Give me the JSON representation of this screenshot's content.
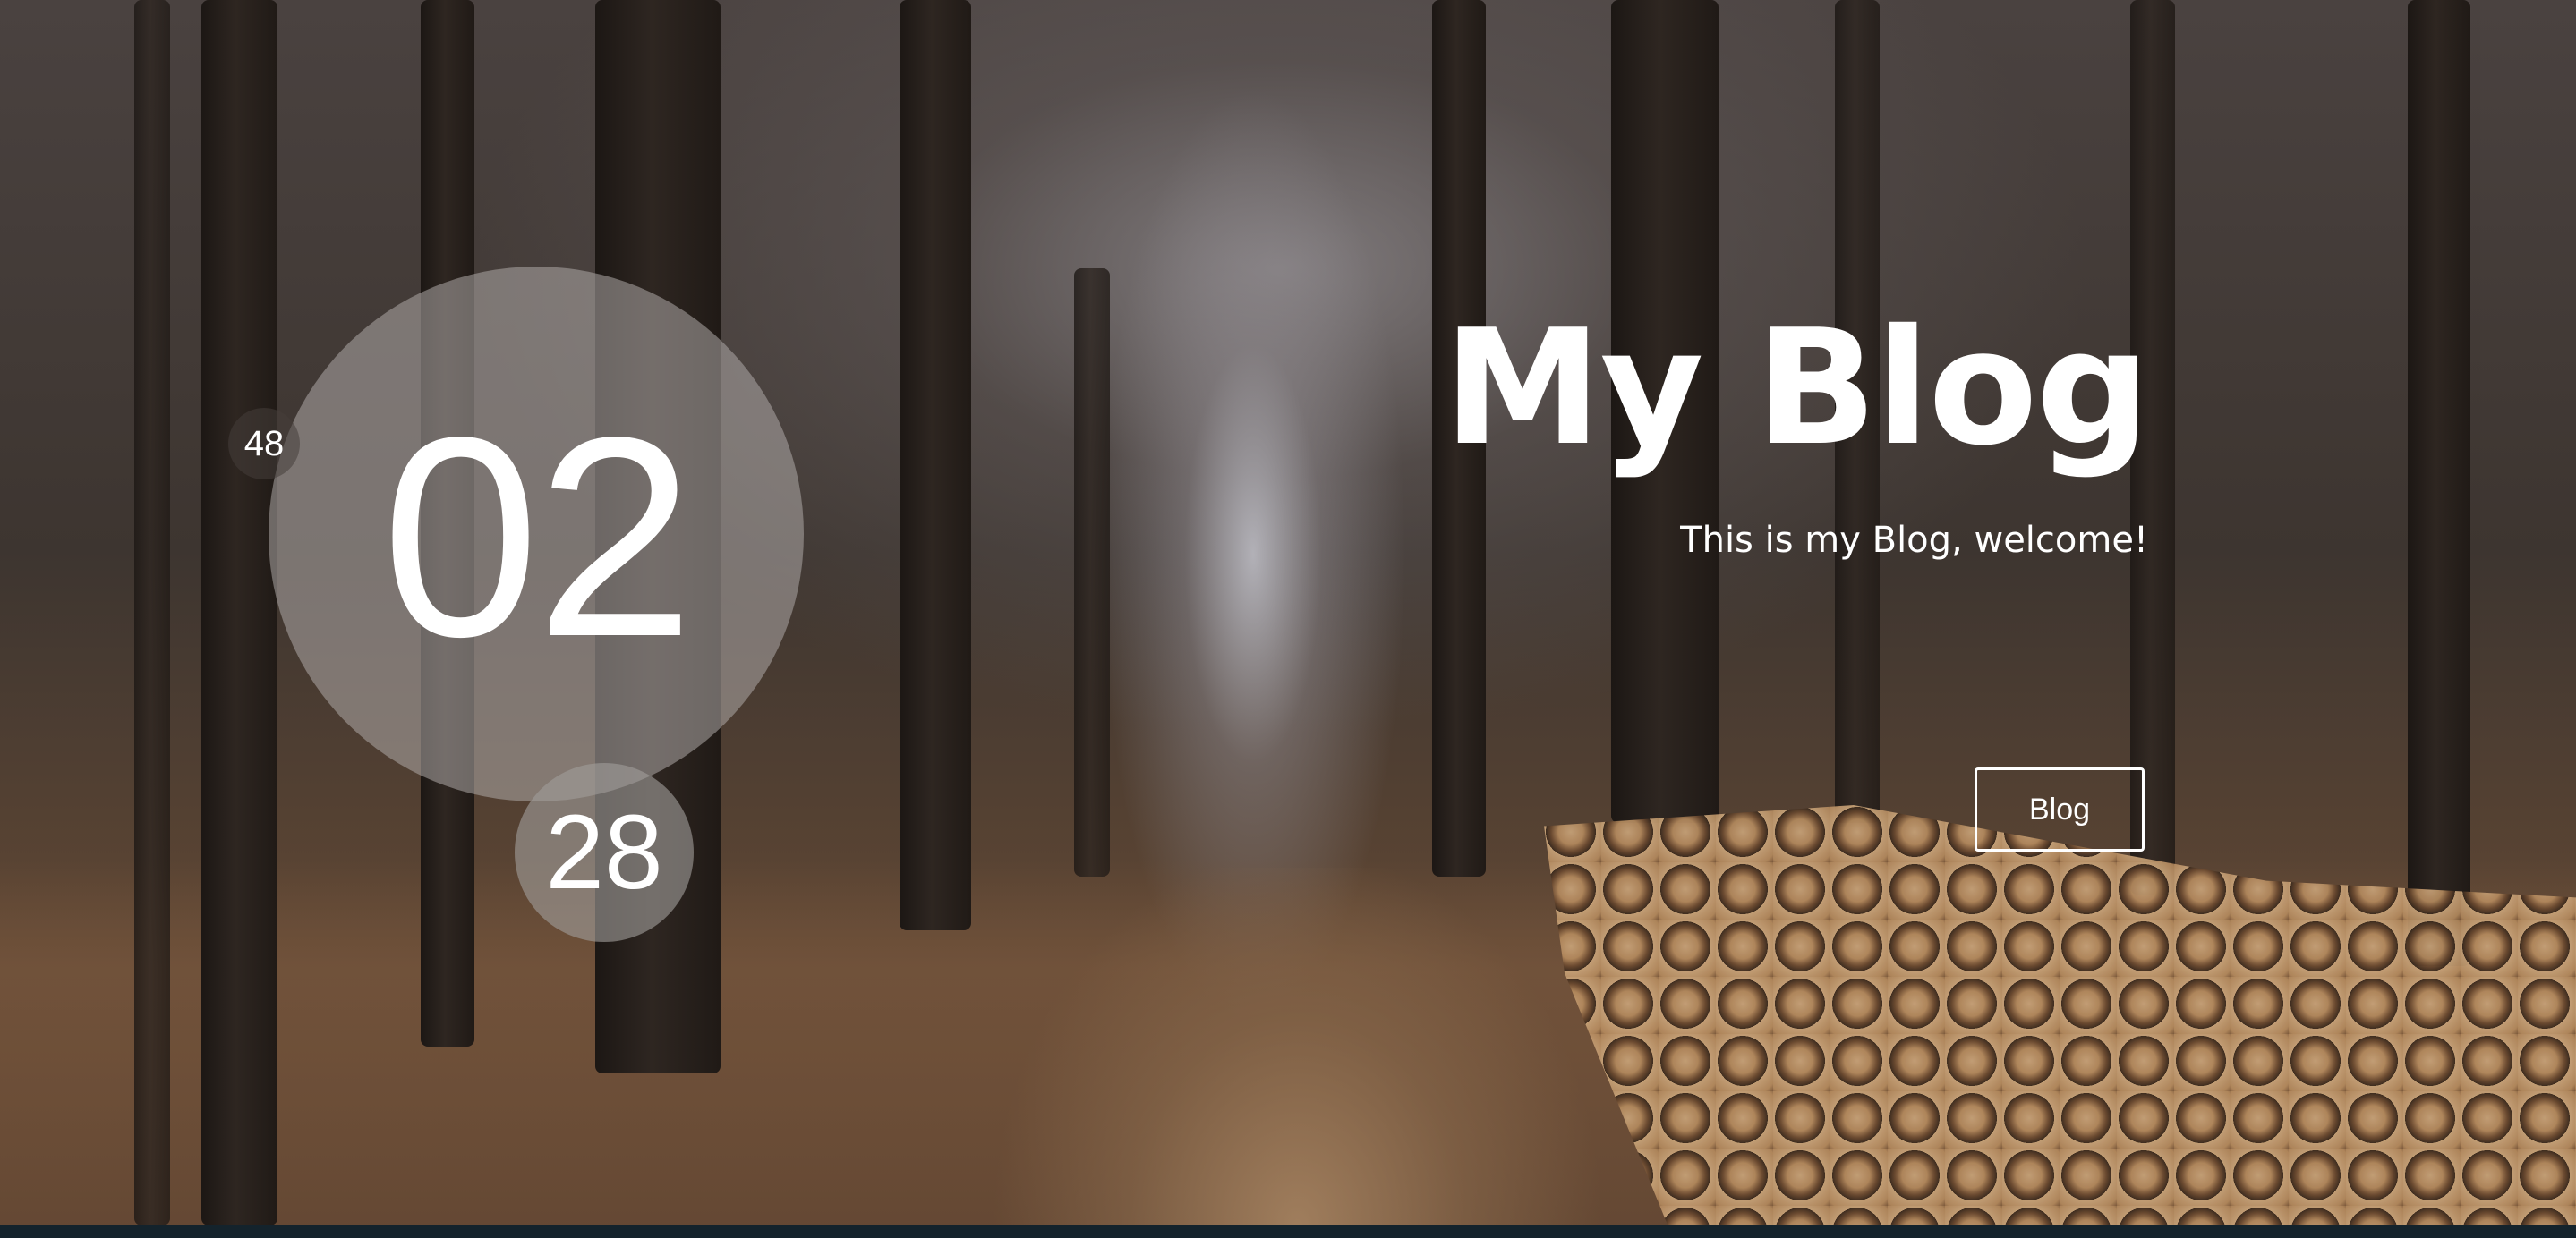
{
  "header": {
    "title": "My Blog",
    "subtitle": "This is my Blog, welcome!"
  },
  "countdown": {
    "primary": "02",
    "secondary": "28",
    "tertiary": "48"
  },
  "nav": {
    "blog_button_label": "Blog"
  },
  "background": {
    "scene": "forest-path-with-log-pile",
    "footer_bar_color": "#14232c"
  }
}
